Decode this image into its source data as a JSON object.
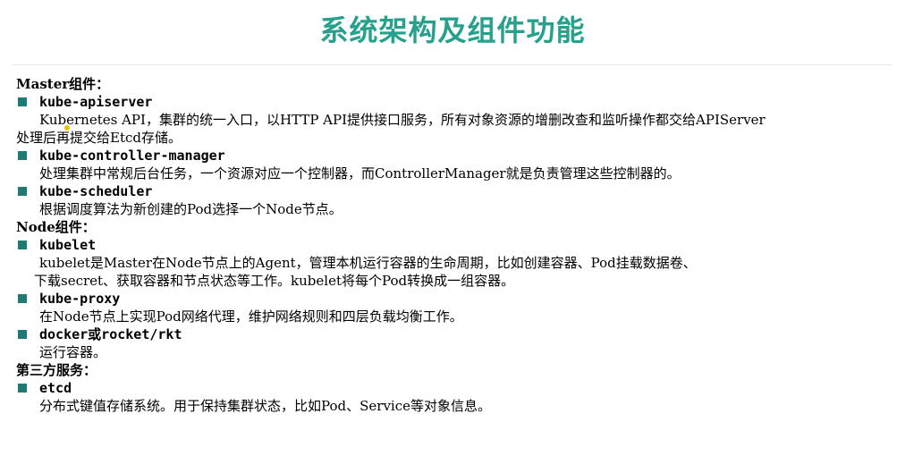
{
  "slide": {
    "title": "系统架构及组件功能",
    "sections": {
      "master": {
        "heading": "Master组件：",
        "items": [
          {
            "name": "kube-apiserver",
            "desc_line1": "Kubernetes API，集群的统一入口，以HTTP API提供接口服务，所有对象资源的增删改查和监听操作都交给APIServer",
            "desc_line2": "处理后再提交给Etcd存储。"
          },
          {
            "name": "kube-controller-manager",
            "desc_line1": "处理集群中常规后台任务，一个资源对应一个控制器，而ControllerManager就是负责管理这些控制器的。"
          },
          {
            "name": "kube-scheduler",
            "desc_line1": "根据调度算法为新创建的Pod选择一个Node节点。"
          }
        ]
      },
      "node": {
        "heading": "Node组件：",
        "items": [
          {
            "name": "kubelet",
            "desc_line1": "kubelet是Master在Node节点上的Agent，管理本机运行容器的生命周期，比如创建容器、Pod挂载数据卷、",
            "desc_line2": "下载secret、获取容器和节点状态等工作。kubelet将每个Pod转换成一组容器。"
          },
          {
            "name": "kube-proxy",
            "desc_line1": "在Node节点上实现Pod网络代理，维护网络规则和四层负载均衡工作。"
          },
          {
            "name": "docker或rocket/rkt",
            "desc_line1": "运行容器。"
          }
        ]
      },
      "third_party": {
        "heading": "第三方服务：",
        "items": [
          {
            "name": "etcd",
            "desc_line1": "分布式键值存储系统。用于保持集群状态，比如Pod、Service等对象信息。"
          }
        ]
      }
    }
  },
  "colors": {
    "title": "#27a08c",
    "bullet": "#1e7a72",
    "text": "#000000",
    "background": "#ffffff"
  }
}
